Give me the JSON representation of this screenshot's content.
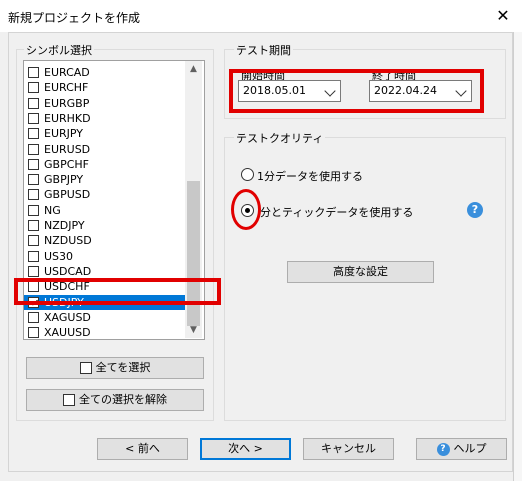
{
  "window": {
    "title": "新規プロジェクトを作成",
    "close_icon": "close-icon"
  },
  "symbols": {
    "group_label": "シンボル選択",
    "items": [
      {
        "label": "EURCAD",
        "checked": false
      },
      {
        "label": "EURCHF",
        "checked": false
      },
      {
        "label": "EURGBP",
        "checked": false
      },
      {
        "label": "EURHKD",
        "checked": false
      },
      {
        "label": "EURJPY",
        "checked": false
      },
      {
        "label": "EURUSD",
        "checked": false
      },
      {
        "label": "GBPCHF",
        "checked": false
      },
      {
        "label": "GBPJPY",
        "checked": false
      },
      {
        "label": "GBPUSD",
        "checked": false
      },
      {
        "label": "NG",
        "checked": false
      },
      {
        "label": "NZDJPY",
        "checked": false
      },
      {
        "label": "NZDUSD",
        "checked": false
      },
      {
        "label": "US30",
        "checked": false
      },
      {
        "label": "USDCAD",
        "checked": false
      },
      {
        "label": "USDCHF",
        "checked": false
      },
      {
        "label": "USDJPY",
        "checked": true,
        "selected": true
      },
      {
        "label": "XAGUSD",
        "checked": false
      },
      {
        "label": "XAUUSD",
        "checked": false
      }
    ],
    "select_all": "全てを選択",
    "deselect_all": "全ての選択を解除"
  },
  "test_period": {
    "group_label": "テスト期間",
    "start_label": "開始時間",
    "start_value": "2018.05.01",
    "end_label": "終了時間",
    "end_value": "2022.04.24"
  },
  "quality": {
    "group_label": "テストクオリティ",
    "option1": "1分データを使用する",
    "option2": "分とティックデータを使用する",
    "selected": 2,
    "advanced": "高度な設定"
  },
  "footer": {
    "back": "< 前へ",
    "next": "次へ >",
    "cancel": "キャンセル",
    "help": "ヘルプ"
  },
  "colors": {
    "highlight": "#e10000",
    "selection": "#0078d7"
  }
}
